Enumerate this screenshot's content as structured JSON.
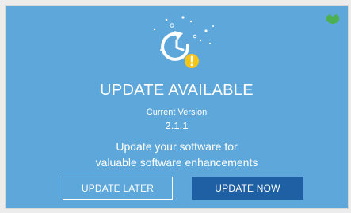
{
  "dialog": {
    "title": "UPDATE AVAILABLE",
    "version_label": "Current Version",
    "version_value": "2.1.1",
    "message_line1": "Update your software for",
    "message_line2": "valuable software enhancements"
  },
  "buttons": {
    "later_label": "UPDATE LATER",
    "now_label": "UPDATE NOW"
  },
  "icons": {
    "hero": "update-clock-warning-icon",
    "corner": "green-badge-icon"
  },
  "colors": {
    "background": "#5da7db",
    "primary_button": "#1f5fa3",
    "warning": "#f5c518",
    "badge": "#4caf50"
  }
}
